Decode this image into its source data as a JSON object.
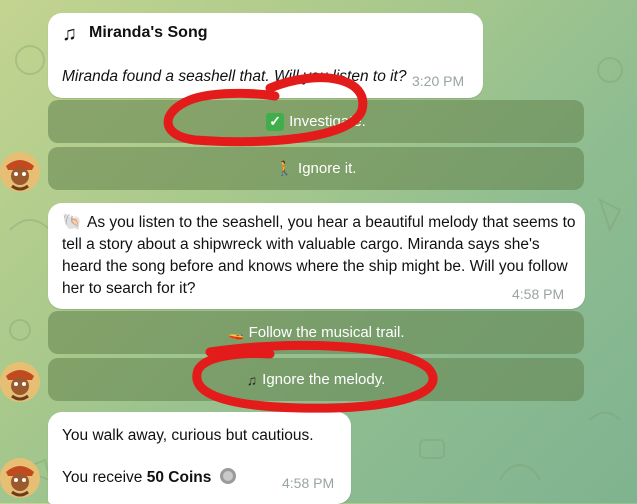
{
  "messages": [
    {
      "title_icon": "music-note-icon",
      "title": "Miranda's Song",
      "text": "Miranda found a seashell that. Will you listen to it?",
      "time": "3:20 PM",
      "buttons": [
        {
          "icon": "check-icon",
          "label": "Investigate."
        },
        {
          "icon": "walking-person-icon",
          "label": "Ignore it."
        }
      ]
    },
    {
      "lead_icon": "shell-icon",
      "text": "As you listen to the seashell, you hear a beautiful melody that seems to tell a story about a shipwreck with valuable cargo. Miranda says she's heard the song before and knows where the ship might be. Will you follow her to search for it?",
      "time": "4:58 PM",
      "buttons": [
        {
          "icon": "boat-icon",
          "label": "Follow the musical trail."
        },
        {
          "icon": "music-notes-icon",
          "label": "Ignore the melody."
        }
      ]
    },
    {
      "line1": "You walk away, curious but cautious.",
      "line2_prefix": "You receive ",
      "line2_bold": "50 Coins",
      "coin_icon": "coin-icon",
      "time": "4:58 PM"
    }
  ],
  "colors": {
    "annotation_red": "#e31b1b",
    "bubble_bg": "#ffffff",
    "keyboard_bg": "#6a8a52"
  }
}
